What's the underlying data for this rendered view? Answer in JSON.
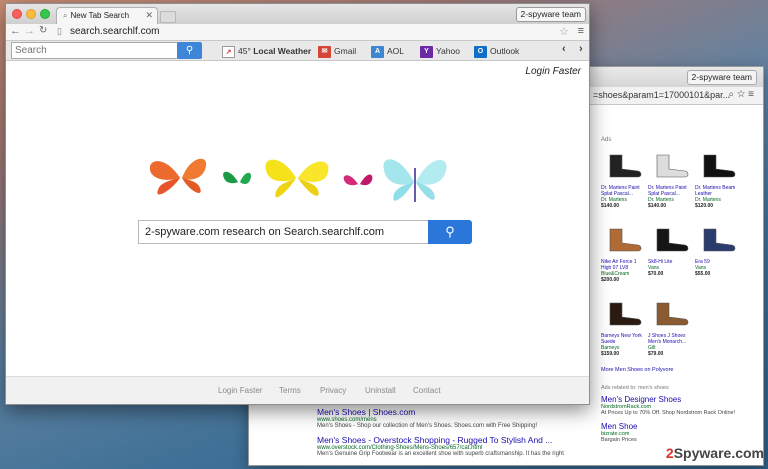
{
  "front": {
    "tab_title": "New Tab Search",
    "profile": "2-spyware team",
    "url": "search.searchlf.com",
    "ext_search_placeholder": "Search",
    "weather_temp": "45°",
    "weather_label": "Local Weather",
    "links": {
      "gmail": "Gmail",
      "aol": "AOL",
      "yahoo": "Yahoo",
      "outlook": "Outlook"
    },
    "login": "Login Faster",
    "search_value": "2-spyware.com research on Search.searchlf.com",
    "footer": [
      "Login Faster",
      "Terms",
      "Privacy",
      "Uninstall",
      "Contact"
    ]
  },
  "back": {
    "profile": "2-spyware team",
    "url": "=shoes&param1=17000101&par...",
    "ads_heading": "Ads",
    "ads": [
      {
        "name": "Dr. Martens Paint Splat Pascal...",
        "store": "Dr. Martens",
        "price": "$140.00"
      },
      {
        "name": "Dr. Martens Paint Splat Pascal...",
        "store": "Dr. Martens",
        "price": "$140.00"
      },
      {
        "name": "Dr. Martens Beam Leather",
        "store": "Dr. Martens",
        "price": "$120.00"
      },
      {
        "name": "Nike Air Force 1 High 07 LV8",
        "store": "Blue&Cream",
        "price": "$200.00"
      },
      {
        "name": "Sk8-Hi Lite",
        "store": "Vans",
        "price": "$70.00"
      },
      {
        "name": "Era 59",
        "store": "Vans",
        "price": "$55.00"
      },
      {
        "name": "Barneys New York Suede",
        "store": "Barneys",
        "price": "$159.00"
      },
      {
        "name": "J Shoes J Shoes Men's Monarch...",
        "store": "Gilt",
        "price": "$79.00"
      }
    ],
    "more_link": "More Men Shoes on Polyvore",
    "side_heading": "Ads related to: men's shoes",
    "side_ads": [
      {
        "title": "Men's Designer Shoes",
        "url": "NordstromRack.com",
        "desc": "At Prices Up to 70% Off. Shop Nordstrom Rack Online!"
      },
      {
        "title": "Men Shoe",
        "url": "bizrate.com",
        "desc": "Bargain Prices"
      }
    ],
    "results": [
      {
        "title": "Men's Shoes | Shoes.com",
        "url": "www.shoes.com/mens",
        "desc": "Men's Shoes - Shop our collection of Men's Shoes. Shoes.com with Free Shipping!"
      },
      {
        "title": "Men's Shoes - Overstock Shopping - Rugged To Stylish And ...",
        "url": "www.overstock.com/Clothing-Shoes/Mens-Shoes/657/cat.html",
        "desc": "Men's Genuine Grip Footwear is an excellent shoe with superb craftsmanship. It has the right"
      }
    ]
  },
  "watermark": {
    "prefix": "2",
    "brand": "Spyware",
    "suffix": ".com"
  },
  "colors": {
    "accent_blue": "#2b77d9",
    "link_blue": "#1a0dab",
    "url_green": "#006621"
  }
}
